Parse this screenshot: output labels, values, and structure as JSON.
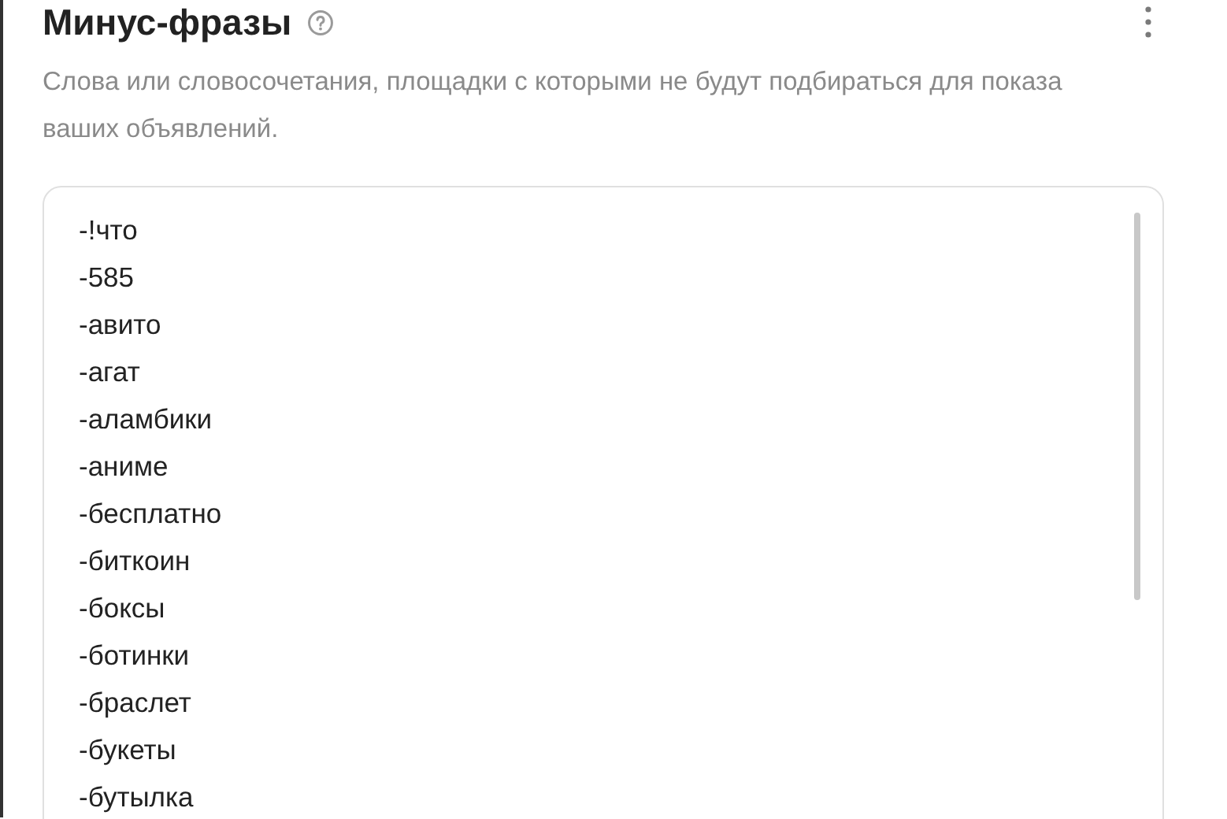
{
  "section": {
    "title": "Минус-фразы",
    "description": "Слова или словосочетания, площадки с которыми не будут подбираться для показа ваших объявлений."
  },
  "phrases": [
    "-!что",
    "-585",
    "-авито",
    "-агат",
    "-аламбики",
    "-аниме",
    "-бесплатно",
    "-биткоин",
    "-боксы",
    "-ботинки",
    "-браслет",
    "-букеты",
    "-бутылка"
  ]
}
